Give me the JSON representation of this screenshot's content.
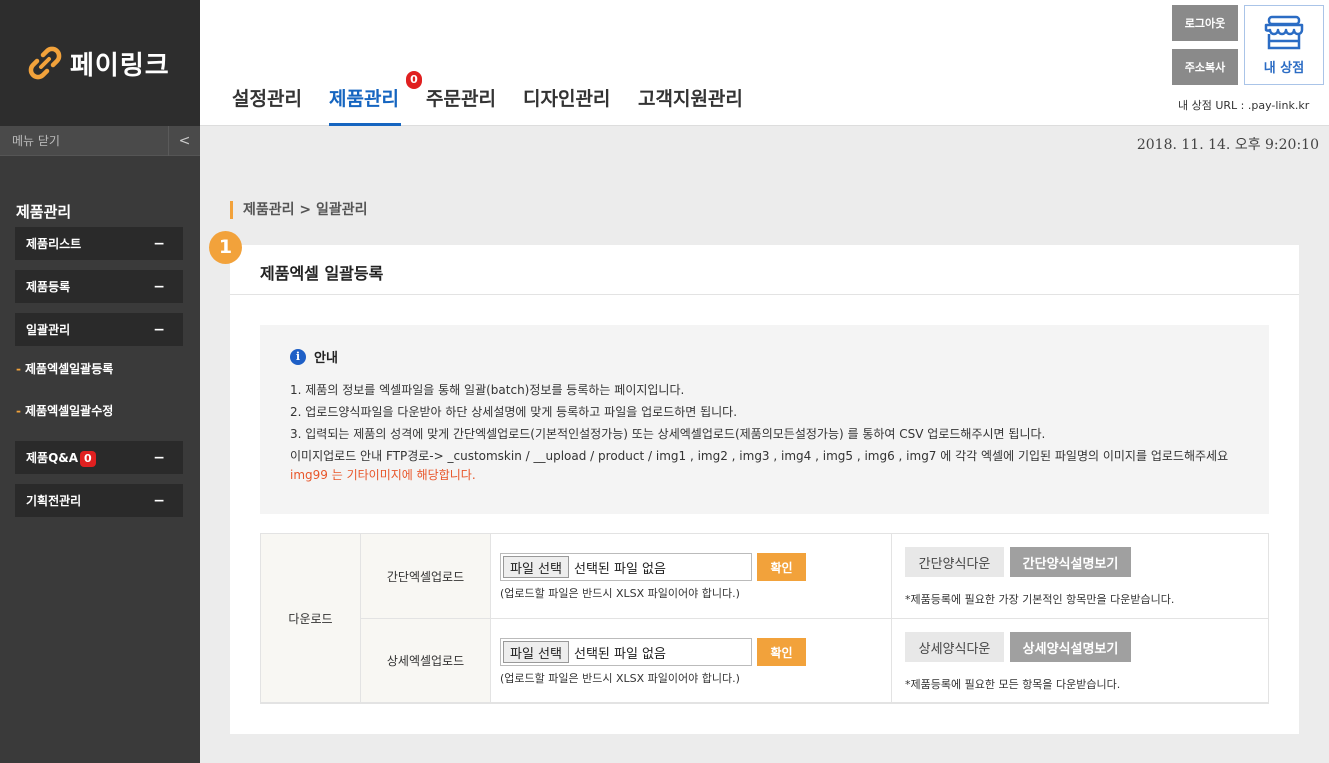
{
  "brand": {
    "name": "페이링크",
    "accent_color": "#f2a23b"
  },
  "sidebar": {
    "menu_close_label": "메뉴 닫기",
    "menu_close_icon": "<",
    "section_title": "제품관리",
    "items": [
      {
        "label": "제품리스트",
        "toggle": "−"
      },
      {
        "label": "제품등록",
        "toggle": "−"
      },
      {
        "label": "일괄관리",
        "toggle": "−"
      },
      {
        "label": "제품Q&A",
        "badge": "0",
        "toggle": "−"
      },
      {
        "label": "기획전관리",
        "toggle": "−"
      }
    ],
    "sub_items": [
      {
        "dash": "-",
        "label": "제품엑셀일괄등록"
      },
      {
        "dash": "-",
        "label": "제품엑셀일괄수정"
      }
    ]
  },
  "nav": {
    "tabs": [
      {
        "label": "설정관리"
      },
      {
        "label": "제품관리",
        "active": true
      },
      {
        "label": "주문관리"
      },
      {
        "label": "디자인관리"
      },
      {
        "label": "고객지원관리"
      }
    ],
    "badge": "0",
    "active_color": "#1565c0"
  },
  "top_actions": {
    "logout": "로그아웃",
    "copy_address": "주소복사",
    "my_store": "내 상점",
    "store_url": "내 상점 URL : .pay-link.kr"
  },
  "datetime": "2018. 11. 14. 오후 9:20:10",
  "breadcrumb": "제품관리 > 일괄관리",
  "step_number": "1",
  "panel": {
    "title": "제품엑셀 일괄등록",
    "notice": {
      "icon": "i",
      "heading": "안내",
      "lines": [
        "1. 제품의 정보를 엑셀파일을 통해 일괄(batch)정보를 등록하는 페이지입니다.",
        "2. 업로드양식파일을 다운받아 하단 상세설명에 맞게 등록하고 파일을 업로드하면 됩니다.",
        "3. 입력되는 제품의 성격에 맞게 간단엑셀업로드(기본적인설정가능) 또는 상세엑셀업로드(제품의모든설정가능) 를 통하여 CSV 업로드해주시면 됩니다.",
        "이미지업로드 안내 FTP경로-> _customskin / __upload / product / img1 , img2 , img3 , img4 , img5 , img6 , img7 에 각각 엑셀에 기입된 파일명의 이미지를 업로드해주세요"
      ],
      "warning": "img99 는 기타이미지에 해당합니다."
    },
    "table": {
      "row_label": "다운로드",
      "rows": [
        {
          "type": "간단엑셀업로드",
          "file_button": "파일 선택",
          "file_status": "선택된 파일 없음",
          "confirm": "확인",
          "hint": "(업로드할 파일은 반드시 XLSX 파일이어야 합니다.)",
          "download": "간단양식다운",
          "guide": "간단양식설명보기",
          "note": "*제품등록에 필요한 가장 기본적인 항목만을 다운받습니다."
        },
        {
          "type": "상세엑셀업로드",
          "file_button": "파일 선택",
          "file_status": "선택된 파일 없음",
          "confirm": "확인",
          "hint": "(업로드할 파일은 반드시 XLSX 파일이어야 합니다.)",
          "download": "상세양식다운",
          "guide": "상세양식설명보기",
          "note": "*제품등록에 필요한 모든 항목을 다운받습니다."
        }
      ]
    }
  }
}
